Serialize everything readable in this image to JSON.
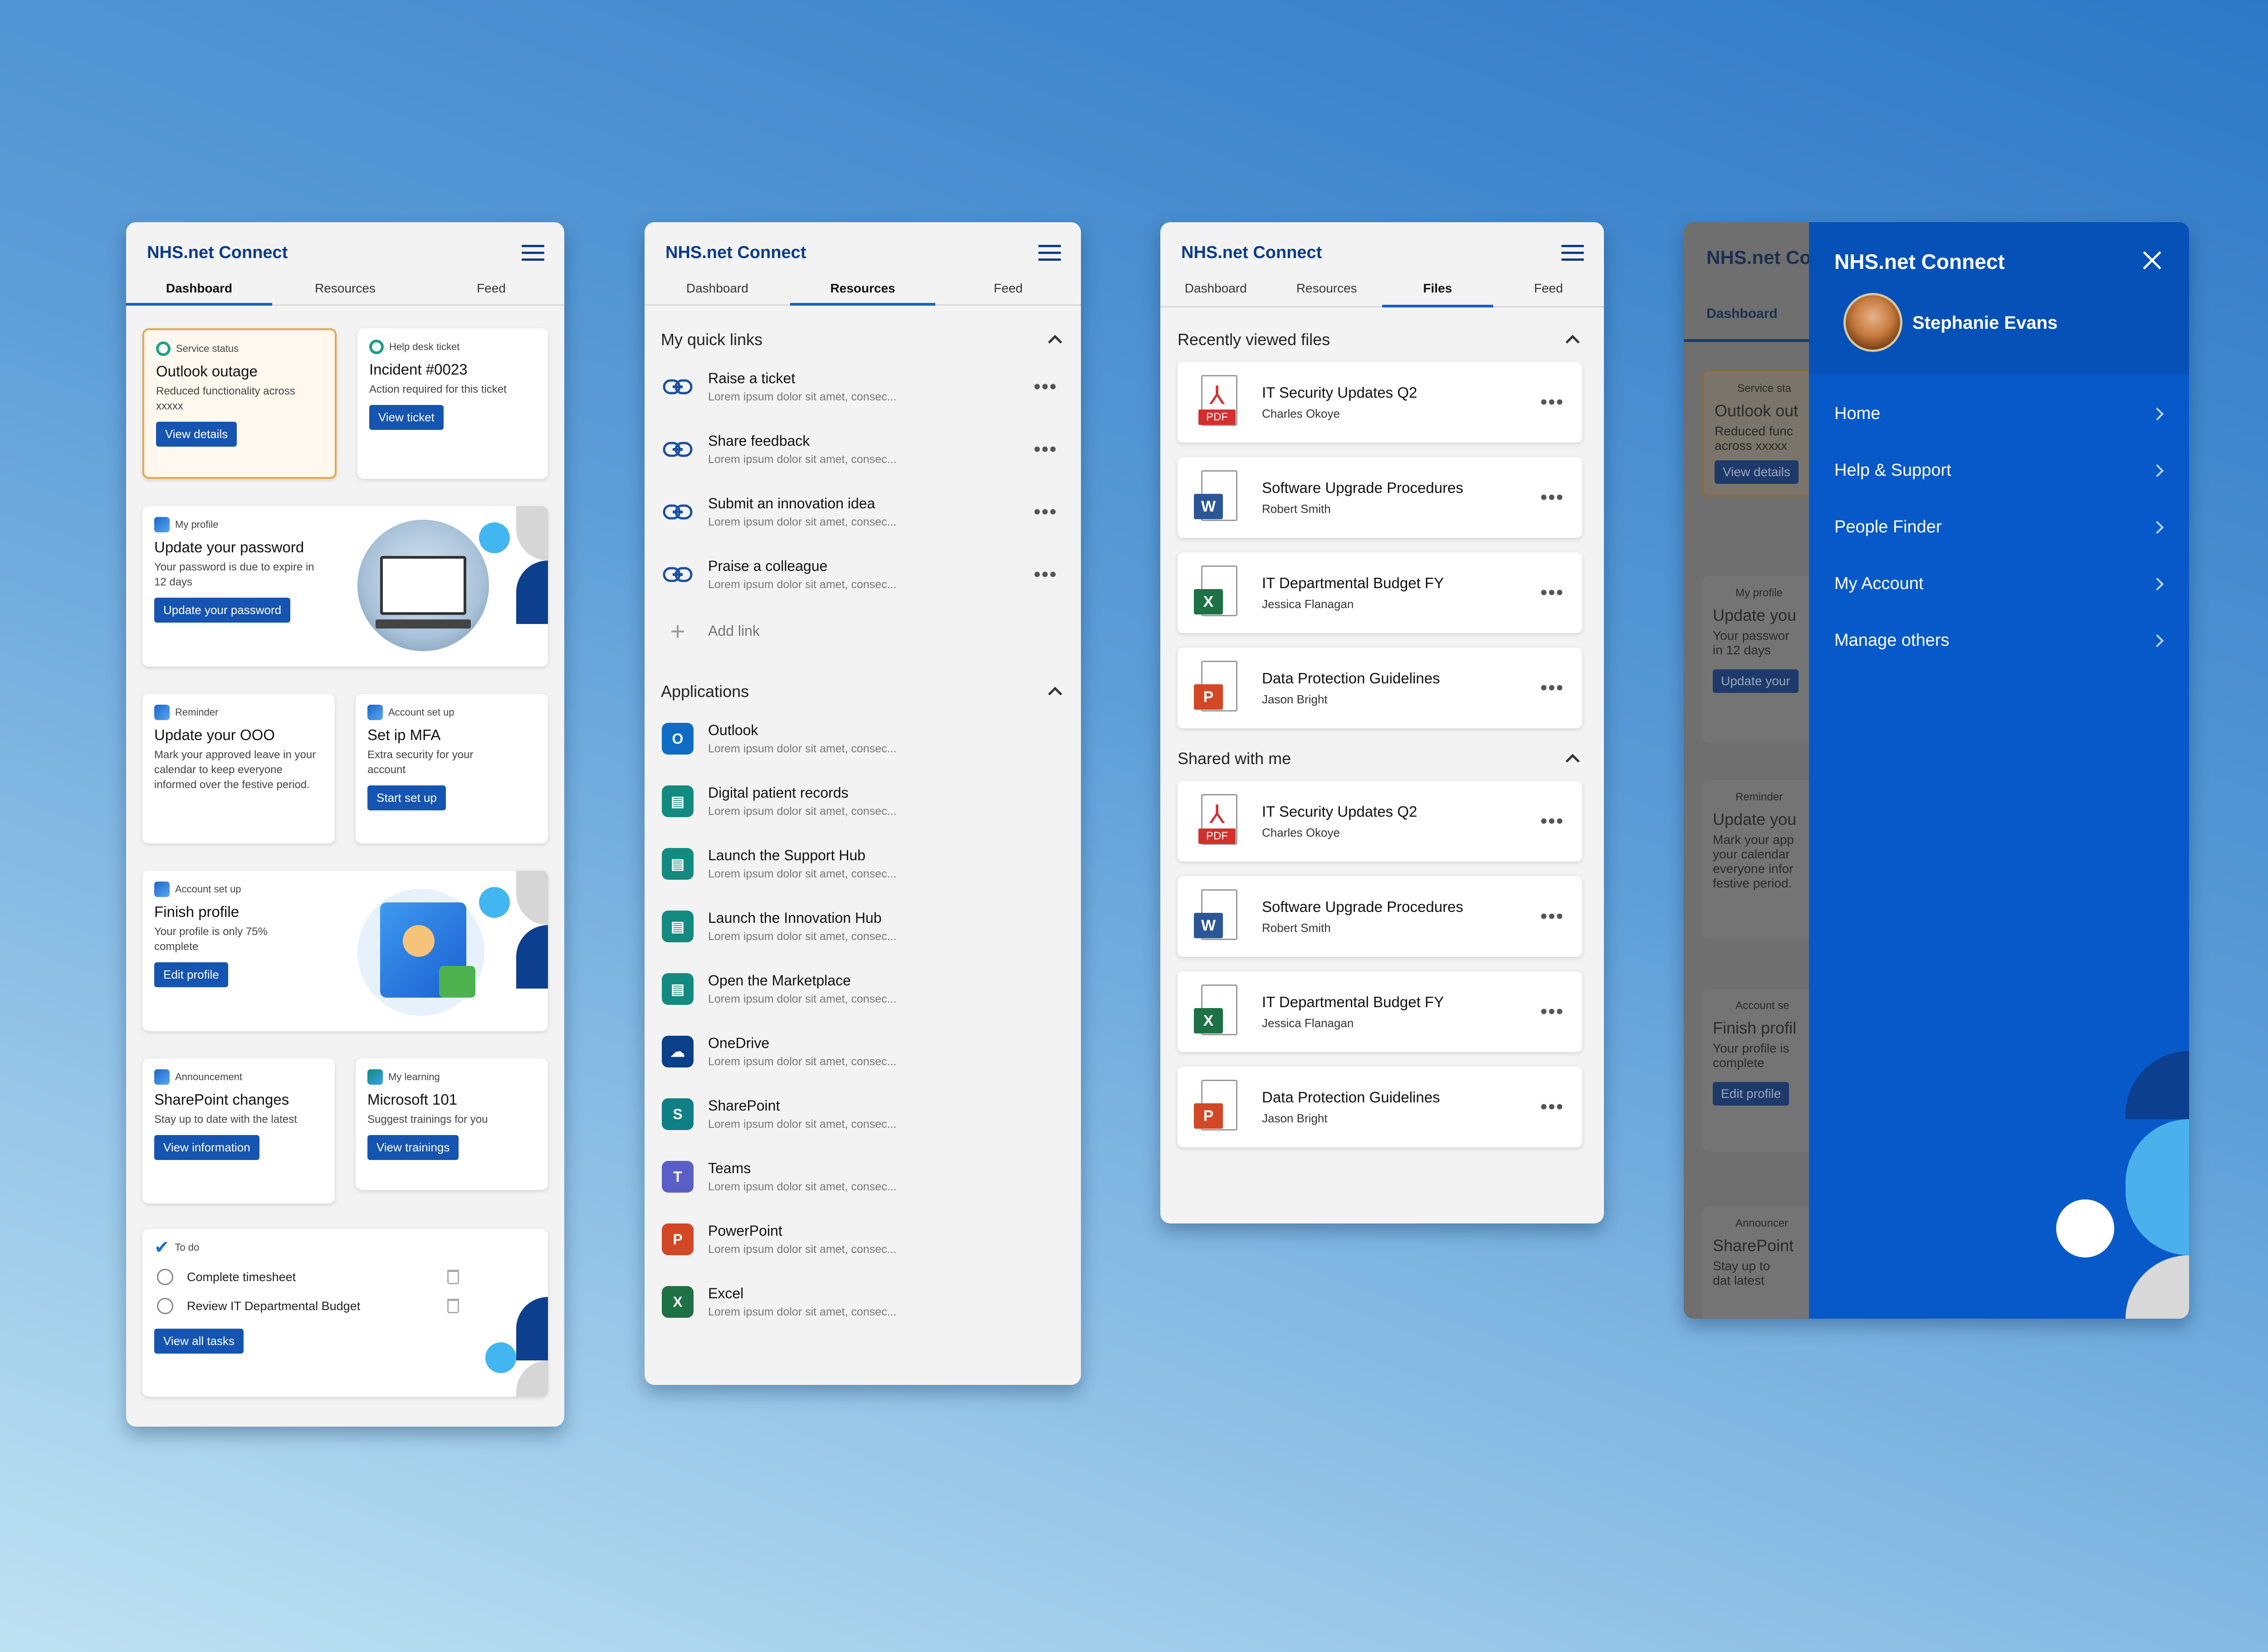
{
  "app": {
    "brand": "NHS.net Connect"
  },
  "colors": {
    "primary": "#1554b0",
    "brand_text": "#0b3b88",
    "drawer_bg": "#0759c9",
    "warning_border": "#e8a64c"
  },
  "dashboard": {
    "tabs": [
      "Dashboard",
      "Resources",
      "Feed"
    ],
    "service_status": {
      "category": "Service status",
      "title": "Outlook outage",
      "desc": "Reduced functionality across xxxxx",
      "button": "View details"
    },
    "helpdesk": {
      "category": "Help desk ticket",
      "title": "Incident #0023",
      "desc": "Action required for this ticket",
      "button": "View ticket"
    },
    "profile": {
      "category": "My profile",
      "title": "Update your password",
      "desc": "Your password is due to expire in 12 days",
      "button": "Update your password"
    },
    "reminder": {
      "category": "Reminder",
      "title": "Update your OOO",
      "desc": "Mark your approved leave in your calendar to keep everyone informed over the festive period."
    },
    "mfa": {
      "category": "Account set up",
      "title": "Set ip MFA",
      "desc": "Extra security for your account",
      "button": "Start set up"
    },
    "finish_profile": {
      "category": "Account set up",
      "title": "Finish profile",
      "desc": "Your profile is only 75% complete",
      "button": "Edit profile",
      "progress_percent": 75
    },
    "announcement": {
      "category": "Announcement",
      "title": "SharePoint changes",
      "desc": "Stay up to date with the latest",
      "button": "View information"
    },
    "learning": {
      "category": "My learning",
      "title": "Microsoft 101",
      "desc": "Suggest trainings for you",
      "button": "View trainings"
    },
    "todo": {
      "category": "To do",
      "items": [
        "Complete timesheet",
        "Review IT Departmental Budget"
      ],
      "button": "View all tasks"
    }
  },
  "resources": {
    "tabs": [
      "Dashboard",
      "Resources",
      "Feed"
    ],
    "quick_links_title": "My quick links",
    "quick_links": [
      {
        "title": "Raise a ticket",
        "sub": "Lorem ipsum dolor sit amet, consec..."
      },
      {
        "title": "Share feedback",
        "sub": "Lorem ipsum dolor sit amet, consec..."
      },
      {
        "title": "Submit an innovation idea",
        "sub": "Lorem ipsum dolor sit amet, consec..."
      },
      {
        "title": "Praise a colleague",
        "sub": "Lorem ipsum dolor sit amet, consec..."
      }
    ],
    "add_link": "Add link",
    "applications_title": "Applications",
    "applications": [
      {
        "title": "Outlook",
        "sub": "Lorem ipsum dolor sit amet, consec...",
        "icon": "outlook-icon",
        "color": "#0f6cc4"
      },
      {
        "title": "Digital patient records",
        "sub": "Lorem ipsum dolor sit amet, consec...",
        "icon": "records-icon",
        "color": "#138a80"
      },
      {
        "title": "Launch the Support Hub",
        "sub": "Lorem ipsum dolor sit amet, consec...",
        "icon": "support-hub-icon",
        "color": "#138a80"
      },
      {
        "title": "Launch the Innovation Hub",
        "sub": "Lorem ipsum dolor sit amet, consec...",
        "icon": "innovation-hub-icon",
        "color": "#138a80"
      },
      {
        "title": "Open the Marketplace",
        "sub": "Lorem ipsum dolor sit amet, consec...",
        "icon": "marketplace-icon",
        "color": "#138a80"
      },
      {
        "title": "OneDrive",
        "sub": "Lorem ipsum dolor sit amet, consec...",
        "icon": "onedrive-icon",
        "color": "#0a3f8a"
      },
      {
        "title": "SharePoint",
        "sub": "Lorem ipsum dolor sit amet, consec...",
        "icon": "sharepoint-icon",
        "color": "#0f7f86"
      },
      {
        "title": "Teams",
        "sub": "Lorem ipsum dolor sit amet, consec...",
        "icon": "teams-icon",
        "color": "#5a5fc7"
      },
      {
        "title": "PowerPoint",
        "sub": "Lorem ipsum dolor sit amet, consec...",
        "icon": "powerpoint-icon",
        "color": "#d24726"
      },
      {
        "title": "Excel",
        "sub": "Lorem ipsum dolor sit amet, consec...",
        "icon": "excel-icon",
        "color": "#1e7145"
      }
    ]
  },
  "files": {
    "tabs": [
      "Dashboard",
      "Resources",
      "Files",
      "Feed"
    ],
    "recent_title": "Recently viewed files",
    "shared_title": "Shared with me",
    "recent": [
      {
        "title": "IT Security Updates Q2",
        "owner": "Charles Okoye",
        "type": "pdf"
      },
      {
        "title": "Software Upgrade Procedures",
        "owner": "Robert Smith",
        "type": "word"
      },
      {
        "title": "IT Departmental Budget FY",
        "owner": "Jessica Flanagan",
        "type": "excel"
      },
      {
        "title": "Data Protection Guidelines",
        "owner": "Jason Bright",
        "type": "powerpoint"
      }
    ],
    "shared": [
      {
        "title": "IT Security Updates Q2",
        "owner": "Charles Okoye",
        "type": "pdf"
      },
      {
        "title": "Software Upgrade Procedures",
        "owner": "Robert Smith",
        "type": "word"
      },
      {
        "title": "IT Departmental Budget FY",
        "owner": "Jessica Flanagan",
        "type": "excel"
      },
      {
        "title": "Data Protection Guidelines",
        "owner": "Jason Bright",
        "type": "powerpoint"
      }
    ],
    "pdf_label": "PDF"
  },
  "drawer": {
    "user": "Stephanie Evans",
    "items": [
      "Home",
      "Help & Support",
      "People Finder",
      "My Account",
      "Manage others"
    ]
  },
  "behind": {
    "brand": "NHS.net Co",
    "tab": "Dashboard",
    "cards": [
      {
        "cat": "Service sta",
        "title": "Outlook out",
        "desc": "Reduced func across xxxxx",
        "button": "View details"
      },
      {
        "cat": "My profile",
        "title": "Update you",
        "desc": "Your passwor in 12 days",
        "button": "Update your"
      },
      {
        "cat": "Reminder",
        "title": "Update you",
        "desc": "Mark your app your calendar everyone infor festive period."
      },
      {
        "cat": "Account se",
        "title": "Finish profil",
        "desc": "Your profile is complete",
        "button": "Edit profile"
      },
      {
        "cat": "Announcer",
        "title": "SharePoint",
        "desc": "Stay up to dat latest"
      }
    ]
  }
}
